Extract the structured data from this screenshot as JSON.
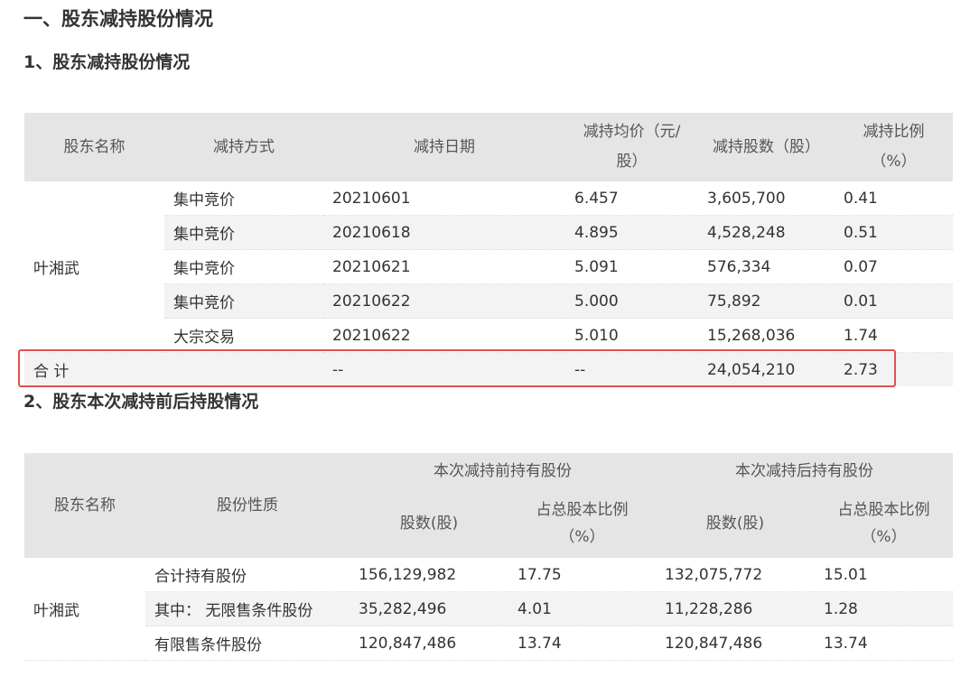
{
  "section_title": "一、股东减持股份情况",
  "sub1_title": "1、股东减持股份情况",
  "sub2_title": "2、股东本次减持前后持股情况",
  "table1": {
    "headers": {
      "name": "股东名称",
      "method": "减持方式",
      "date": "减持日期",
      "price_line1": "减持均价（元/",
      "price_line2": "股）",
      "shares": "减持股数（股）",
      "ratio_line1": "减持比例",
      "ratio_line2": "（%）"
    },
    "shareholder": "叶湘武",
    "rows": [
      {
        "method": "集中竞价",
        "date": "20210601",
        "price": "6.457",
        "shares": "3,605,700",
        "ratio": "0.41"
      },
      {
        "method": "集中竞价",
        "date": "20210618",
        "price": "4.895",
        "shares": "4,528,248",
        "ratio": "0.51"
      },
      {
        "method": "集中竞价",
        "date": "20210621",
        "price": "5.091",
        "shares": "576,334",
        "ratio": "0.07"
      },
      {
        "method": "集中竞价",
        "date": "20210622",
        "price": "5.000",
        "shares": "75,892",
        "ratio": "0.01"
      },
      {
        "method": "大宗交易",
        "date": "20210622",
        "price": "5.010",
        "shares": "15,268,036",
        "ratio": "1.74"
      }
    ],
    "total": {
      "label": "合 计",
      "date": "--",
      "price": "--",
      "shares": "24,054,210",
      "ratio": "2.73"
    }
  },
  "table2": {
    "headers": {
      "name": "股东名称",
      "type": "股份性质",
      "before": "本次减持前持有股份",
      "after": "本次减持后持有股份",
      "shares": "股数(股)",
      "ratio_line1": "占总股本比例",
      "ratio_line2": "（%）"
    },
    "shareholder": "叶湘武",
    "rows": [
      {
        "type": "合计持有股份",
        "before_shares": "156,129,982",
        "before_ratio": "17.75",
        "after_shares": "132,075,772",
        "after_ratio": "15.01"
      },
      {
        "type": "其中： 无限售条件股份",
        "before_shares": "35,282,496",
        "before_ratio": "4.01",
        "after_shares": "11,228,286",
        "after_ratio": "1.28"
      },
      {
        "type": "有限售条件股份",
        "before_shares": "120,847,486",
        "before_ratio": "13.74",
        "after_shares": "120,847,486",
        "after_ratio": "13.74"
      }
    ]
  }
}
